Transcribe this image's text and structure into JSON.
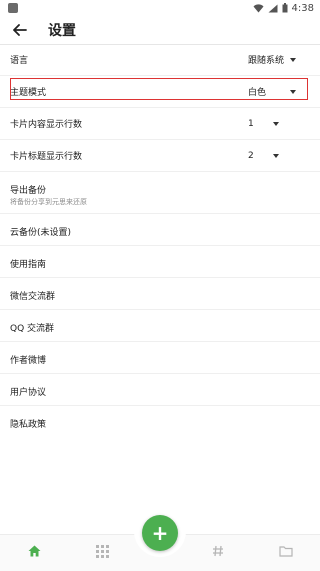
{
  "status": {
    "time": "4:38",
    "icons": [
      "wifi-icon",
      "signal-icon",
      "battery-icon"
    ]
  },
  "header": {
    "title": "设置",
    "back_icon": "arrow-back-icon"
  },
  "settings": [
    {
      "label": "语言",
      "value": "跟随系统"
    },
    {
      "label": "主题模式",
      "value": "白色"
    },
    {
      "label": "卡片内容显示行数",
      "value": "1"
    },
    {
      "label": "卡片标题显示行数",
      "value": "2"
    }
  ],
  "menu": [
    {
      "title": "导出备份",
      "subtitle": "将备份分享到元思来还原"
    },
    {
      "title": "云备份(未设置)"
    },
    {
      "title": "使用指南"
    },
    {
      "title": "微信交流群"
    },
    {
      "title": "QQ 交流群"
    },
    {
      "title": "作者微博"
    },
    {
      "title": "用户协议"
    },
    {
      "title": "隐私政策"
    }
  ],
  "bottom_nav": {
    "fab_label": "+",
    "items": [
      "home-icon",
      "grid-icon",
      "hashtag-icon",
      "folder-icon"
    ]
  },
  "colors": {
    "accent": "#4caf50",
    "highlight": "#dd3333"
  }
}
